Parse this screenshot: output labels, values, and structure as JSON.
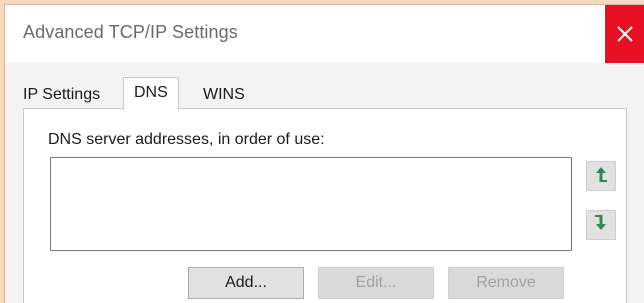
{
  "window": {
    "title": "Advanced TCP/IP Settings",
    "close_icon": "close-icon"
  },
  "tabs": [
    {
      "label": "IP Settings",
      "active": false
    },
    {
      "label": "DNS",
      "active": true
    },
    {
      "label": "WINS",
      "active": false
    }
  ],
  "dns": {
    "list_label": "DNS server addresses, in order of use:",
    "addresses": [],
    "move_up_icon": "arrow-up-icon",
    "move_down_icon": "arrow-down-icon"
  },
  "buttons": {
    "add": "Add...",
    "edit": "Edit...",
    "remove": "Remove"
  },
  "colors": {
    "close_bg": "#e81123",
    "arrow_green": "#2e8b57"
  }
}
